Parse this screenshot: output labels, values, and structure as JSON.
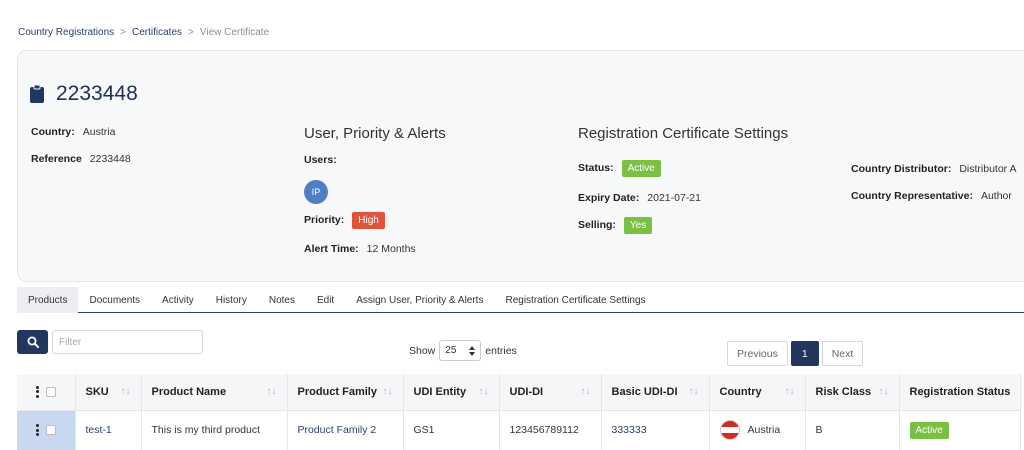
{
  "breadcrumb": [
    "Country Registrations",
    "Certificates",
    "View Certificate"
  ],
  "breadcrumb_sep": ">",
  "header": {
    "title": "2233448"
  },
  "info": {
    "country_label": "Country:",
    "country_value": "Austria",
    "reference_label": "Reference",
    "reference_value": "2233448"
  },
  "user_section": {
    "title": "User, Priority & Alerts",
    "users_label": "Users:",
    "avatar_initials": "IP",
    "priority_label": "Priority:",
    "priority_value": "High",
    "alert_label": "Alert Time:",
    "alert_value": "12 Months"
  },
  "reg_section": {
    "title": "Registration Certificate Settings",
    "status_label": "Status:",
    "status_value": "Active",
    "expiry_label": "Expiry Date:",
    "expiry_value": "2021-07-21",
    "selling_label": "Selling:",
    "selling_value": "Yes",
    "distributor_label": "Country Distributor:",
    "distributor_value": "Distributor A",
    "representative_label": "Country Representative:",
    "representative_value": "Author"
  },
  "tabs": [
    "Products",
    "Documents",
    "Activity",
    "History",
    "Notes",
    "Edit",
    "Assign User, Priority & Alerts",
    "Registration Certificate Settings"
  ],
  "search": {
    "placeholder": "Filter"
  },
  "show": {
    "prefix": "Show",
    "value": "25",
    "suffix": "entries"
  },
  "pager": {
    "prev": "Previous",
    "current": "1",
    "next": "Next"
  },
  "table": {
    "headers": [
      "SKU",
      "Product Name",
      "Product Family",
      "UDI Entity",
      "UDI-DI",
      "Basic UDI-DI",
      "Country",
      "Risk Class",
      "Registration Status"
    ],
    "rows": [
      {
        "sku": "test-1",
        "product_name": "This is my third product",
        "family": "Product Family 2",
        "udi_entity": "GS1",
        "udi_di": "123456789112",
        "basic_udi_di": "333333",
        "country": "Austria",
        "risk": "B",
        "status": "Active"
      }
    ]
  },
  "colors": {
    "accent": "#223760",
    "green": "#7ac143",
    "red": "#e0533b",
    "flag_red": "#d52b1e"
  },
  "icons": {
    "search": "search-icon",
    "title": "clipboard-icon"
  }
}
